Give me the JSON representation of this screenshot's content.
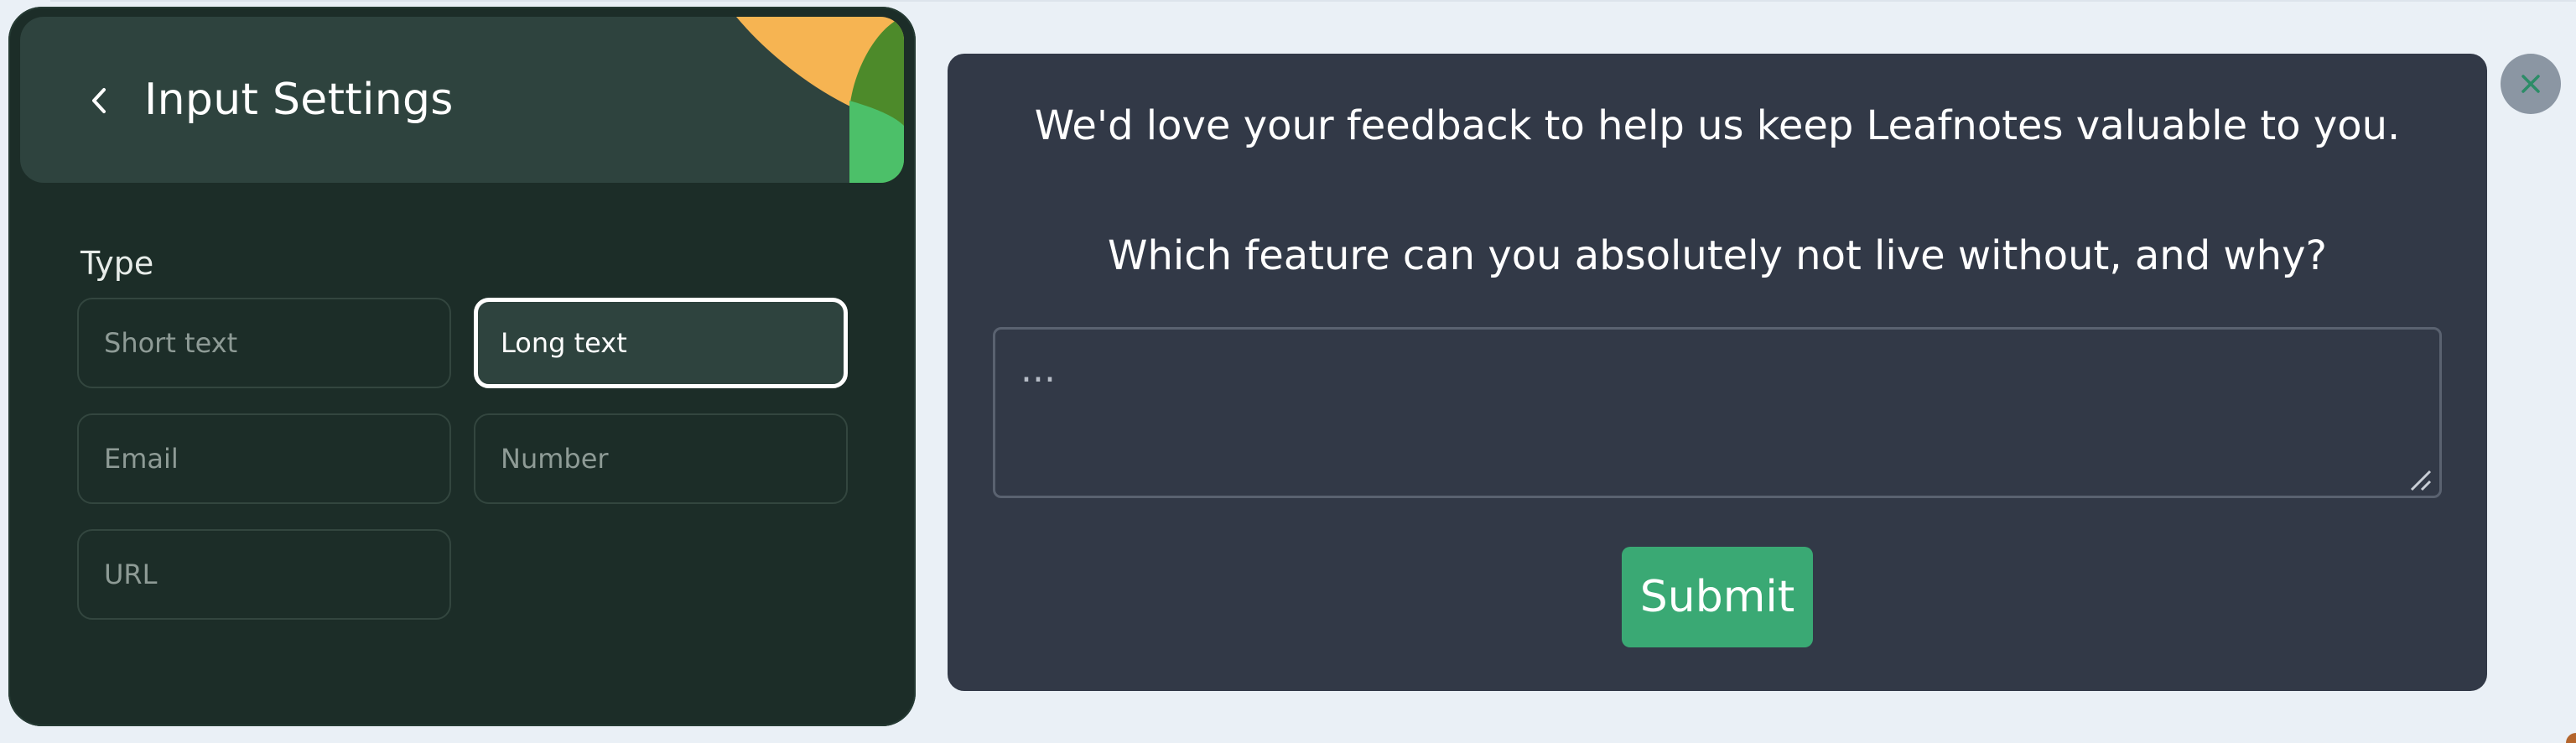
{
  "settings_panel": {
    "title": "Input Settings",
    "back_icon": "chevron-left-icon",
    "type_label": "Type",
    "type_options": [
      {
        "label": "Short text",
        "selected": false
      },
      {
        "label": "Long text",
        "selected": true
      },
      {
        "label": "Email",
        "selected": false
      },
      {
        "label": "Number",
        "selected": false
      },
      {
        "label": "URL",
        "selected": false
      }
    ]
  },
  "feedback": {
    "intro": "We'd love your feedback to help us keep Leafnotes valuable to you.",
    "question": "Which feature can you absolutely not live without, and why?",
    "placeholder": "...",
    "value": "",
    "submit_label": "Submit"
  },
  "close_icon": "close-icon",
  "colors": {
    "panel_bg": "#1c2d28",
    "header_bg": "#2e433e",
    "card_bg": "#323947",
    "submit_green": "#3aa974",
    "accent_orange": "#f6b452",
    "accent_dark_green": "#4d8a2a",
    "accent_light_green": "#4cc069",
    "page_bg": "#eaf0f6"
  }
}
